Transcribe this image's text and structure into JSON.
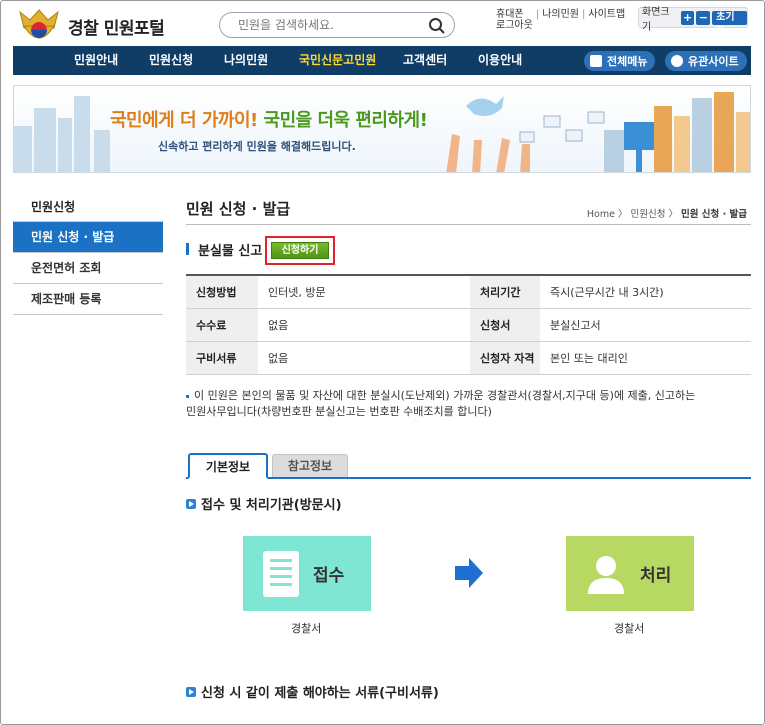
{
  "header": {
    "logo_text": "경찰 민원포털",
    "search_placeholder": "민원을 검색하세요.",
    "util": {
      "mobile": "휴대폰",
      "logout": "로그아웃",
      "my": "나의민원",
      "sitemap": "사이트맵"
    },
    "fontsize": {
      "label": "화면크기",
      "plus": "+",
      "minus": "−",
      "reset": "초기화"
    }
  },
  "gnb": {
    "items": [
      "민원안내",
      "민원신청",
      "나의민원",
      "국민신문고민원",
      "고객센터",
      "이용안내"
    ],
    "active_index": 3,
    "all_menu": "전체메뉴",
    "related": "유관사이트"
  },
  "banner": {
    "headline_1": "국민에게 더 가까이!",
    "headline_2": "국민을 더욱 편리하게!",
    "sub": "신속하고 편리하게 민원을 해결해드립니다."
  },
  "lnb": {
    "title": "민원신청",
    "items": [
      "민원 신청 · 발급",
      "운전면허 조회",
      "제조판매 등록"
    ],
    "active_index": 0
  },
  "page": {
    "title": "민원 신청 · 발급",
    "breadcrumb_home": "Home",
    "breadcrumb_1": "민원신청",
    "breadcrumb_2": "민원 신청 · 발급",
    "section_title": "분실물 신고",
    "apply_button": "신청하기"
  },
  "info_table": {
    "rows": [
      {
        "k1": "신청방법",
        "v1": "인터넷, 방문",
        "k2": "처리기간",
        "v2": "즉시(근무시간 내 3시간)"
      },
      {
        "k1": "수수료",
        "v1": "없음",
        "k2": "신청서",
        "v2": "분실신고서"
      },
      {
        "k1": "구비서류",
        "v1": "없음",
        "k2": "신청자 자격",
        "v2": "본인 또는 대리인"
      }
    ]
  },
  "note": {
    "line1": "이 민원은 본인의 물품 및 자산에 대한 분실시(도난제외) 가까운 경찰관서(경찰서,지구대 등)에 제출, 신고하는",
    "line2": "민원사무입니다(차량번호판 분실신고는 번호판 수배조치를 합니다)"
  },
  "tabs": {
    "basic": "기본정보",
    "reference": "참고정보"
  },
  "process": {
    "heading": "접수 및 처리기관(방문시)",
    "step1": "접수",
    "step1_caption": "경찰서",
    "step2": "처리",
    "step2_caption": "경찰서"
  },
  "docs_heading": "신청 시 같이 제출 해야하는 서류(구비서류)",
  "colors": {
    "navy": "#0f3d66",
    "accent": "#1b72c4",
    "highlight": "#ffd92e",
    "apply_green": "#5aa01c",
    "teal_card": "#7fe6d4",
    "lime_card": "#b8d864"
  }
}
